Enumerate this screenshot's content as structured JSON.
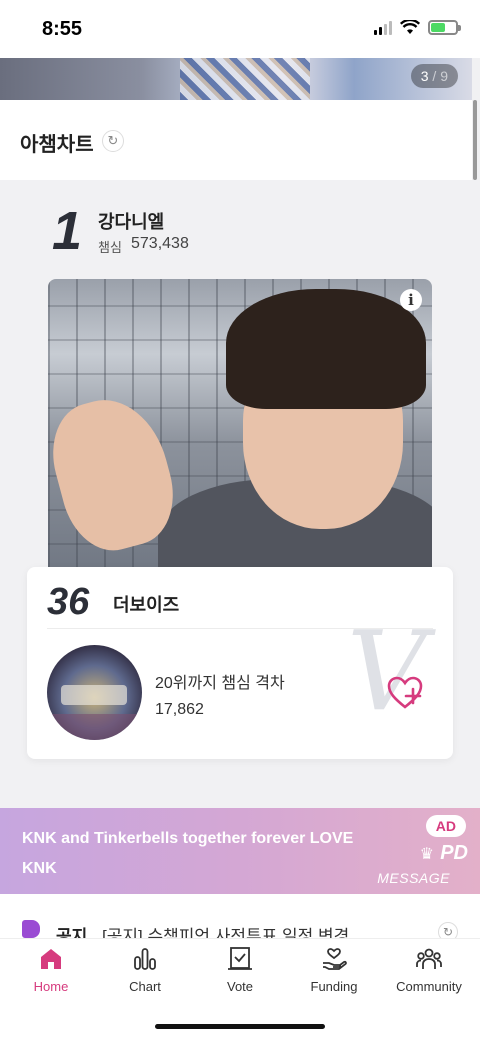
{
  "status_bar": {
    "time": "8:55"
  },
  "banner": {
    "current": "3",
    "separator": " / ",
    "total": "9"
  },
  "section": {
    "title": "아챔차트"
  },
  "top_rank": {
    "rank": "1",
    "name": "강다니엘",
    "score_label": "챔심",
    "score": "573,438"
  },
  "card": {
    "rank": "36",
    "name": "더보이즈",
    "gap_label": "20위까지 챔심 격차",
    "gap_value": "17,862"
  },
  "ad": {
    "text": "KNK and Tinkerbells together forever LOVE KNK",
    "badge": "AD",
    "pd": "PD",
    "message": "MESSAGE"
  },
  "notice": {
    "tag": "공지",
    "text": "[공지] 슈챔피언 사전투표 일정 변경"
  },
  "nav": [
    {
      "label": "Home",
      "icon": "home-icon",
      "active": true
    },
    {
      "label": "Chart",
      "icon": "chart-icon"
    },
    {
      "label": "Vote",
      "icon": "vote-icon"
    },
    {
      "label": "Funding",
      "icon": "funding-icon"
    },
    {
      "label": "Community",
      "icon": "community-icon"
    }
  ],
  "colors": {
    "accent": "#d63b7e",
    "ad_start": "#c6a6df",
    "ad_end": "#e3b0c9",
    "notice_icon": "#9a4bd3"
  }
}
